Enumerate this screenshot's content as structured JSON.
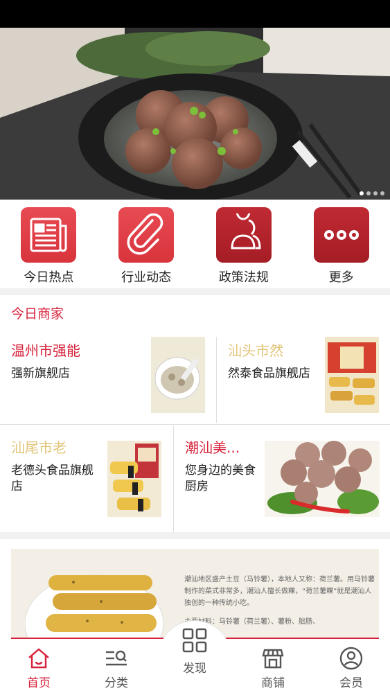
{
  "banner": {
    "dots": 4,
    "active_dot": 1
  },
  "quick_nav": [
    {
      "label": "今日热点",
      "icon": "newspaper-icon"
    },
    {
      "label": "行业动态",
      "icon": "paperclip-icon"
    },
    {
      "label": "政策法规",
      "icon": "users-icon"
    },
    {
      "label": "更多",
      "icon": "more-icon"
    }
  ],
  "merchants_section": {
    "title": "今日商家",
    "items": [
      {
        "name": "温州市强能",
        "desc": "强新旗舰店",
        "name_color": "#d6213a"
      },
      {
        "name": "汕头市然",
        "desc": "然泰食品旗舰店",
        "name_color": "#e0c477"
      },
      {
        "name": "汕尾市老",
        "desc": "老德头食品旗舰店",
        "name_color": "#e0c477"
      },
      {
        "name": "潮汕美...",
        "desc": "您身边的美食厨房",
        "name_color": "#d6213a"
      }
    ]
  },
  "promo": {
    "para1": "潮汕地区盛产土豆（马铃薯），本地人又称：荷兰薯。用马铃薯制作的菜式非常多，潮汕人擅长做粿，“荷兰薯粿”就是潮汕人独创的一种传统小吃。",
    "para2": "主要材料：马铃薯（荷兰薯）、薯粉、朏肠、"
  },
  "tabbar": [
    {
      "label": "首页",
      "icon": "home-icon",
      "active": true
    },
    {
      "label": "分类",
      "icon": "category-icon",
      "active": false
    },
    {
      "label": "发现",
      "icon": "grid-icon",
      "active": false
    },
    {
      "label": "商铺",
      "icon": "shop-icon",
      "active": false
    },
    {
      "label": "会员",
      "icon": "user-icon",
      "active": false
    }
  ],
  "colors": {
    "accent": "#d6213a",
    "icon_red": "#e23e46",
    "gold": "#e0c477"
  }
}
